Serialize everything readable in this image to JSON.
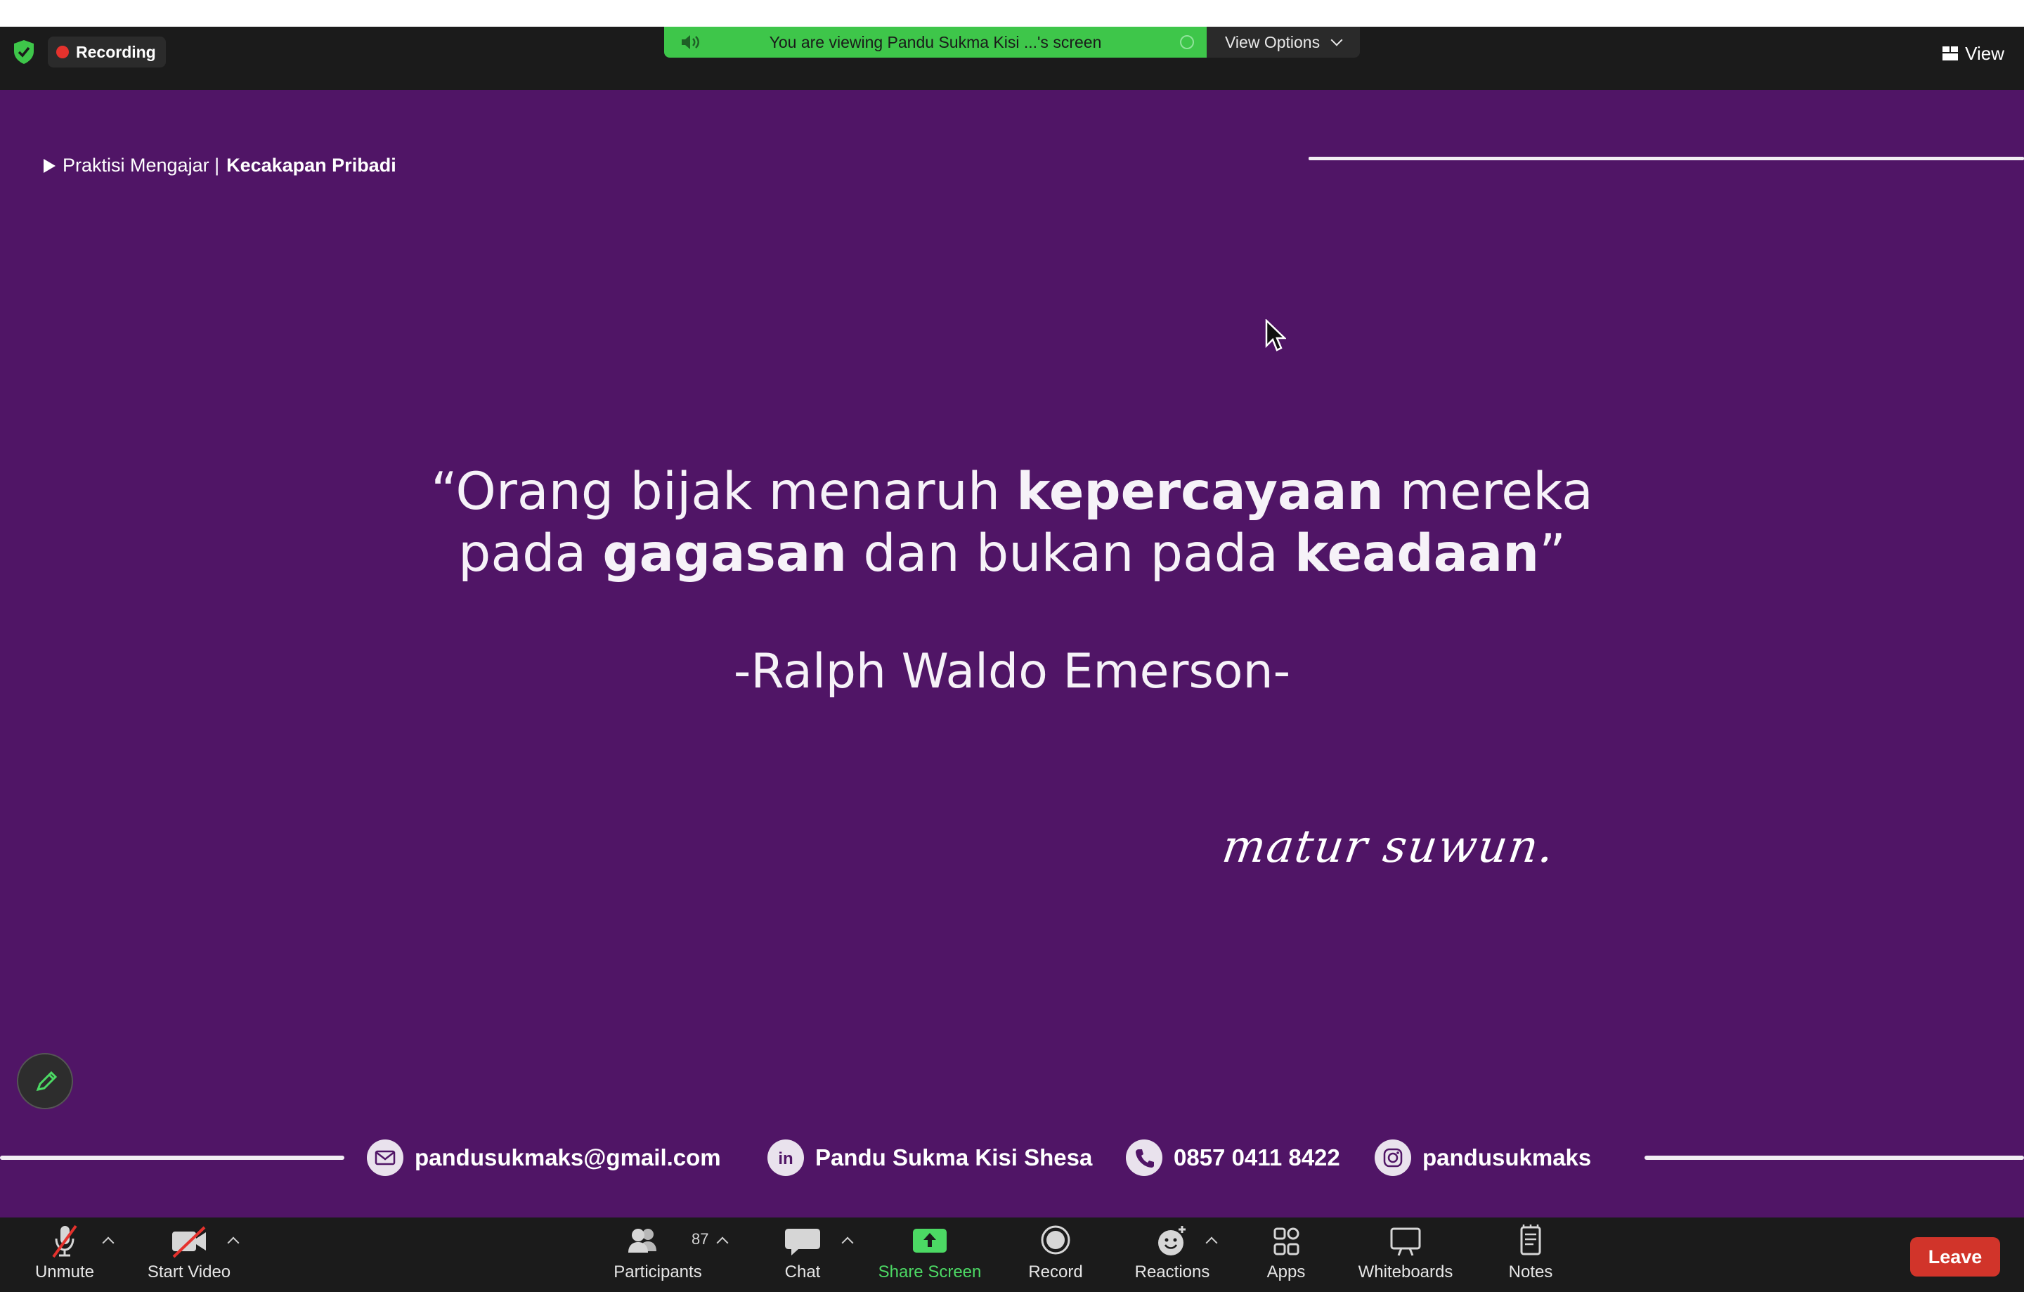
{
  "window": {
    "recording_label": "Recording",
    "viewing_banner": "You are viewing Pandu Sukma Kisi ...'s screen",
    "view_options_label": "View Options",
    "view_label": "View"
  },
  "slide": {
    "header_prefix": "Praktisi Mengajar | ",
    "header_bold": "Kecakapan Pribadi",
    "quote": {
      "l1_a": "“Orang bijak menaruh ",
      "l1_b": "kepercayaan",
      "l1_c": " mereka",
      "l2_a": "pada ",
      "l2_b": "gagasan",
      "l2_c": " dan bukan pada ",
      "l2_d": "keadaan",
      "l2_e": "”"
    },
    "author": "-Ralph Waldo Emerson-",
    "signature": "matur suwun.",
    "contacts": {
      "email": "pandusukmaks@gmail.com",
      "linkedin": "Pandu Sukma Kisi Shesa",
      "phone": "0857 0411 8422",
      "instagram": "pandusukmaks"
    }
  },
  "toolbar": {
    "unmute": "Unmute",
    "start_video": "Start Video",
    "participants": "Participants",
    "participants_count": "87",
    "chat": "Chat",
    "share_screen": "Share Screen",
    "record": "Record",
    "reactions": "Reactions",
    "apps": "Apps",
    "whiteboards": "Whiteboards",
    "notes": "Notes",
    "leave": "Leave"
  },
  "colors": {
    "slide_bg": "#501566",
    "banner_green": "#3ec64a",
    "toolbar_bg": "#1b1b1b",
    "leave_red": "#d1342a",
    "share_green": "#4cd964"
  }
}
